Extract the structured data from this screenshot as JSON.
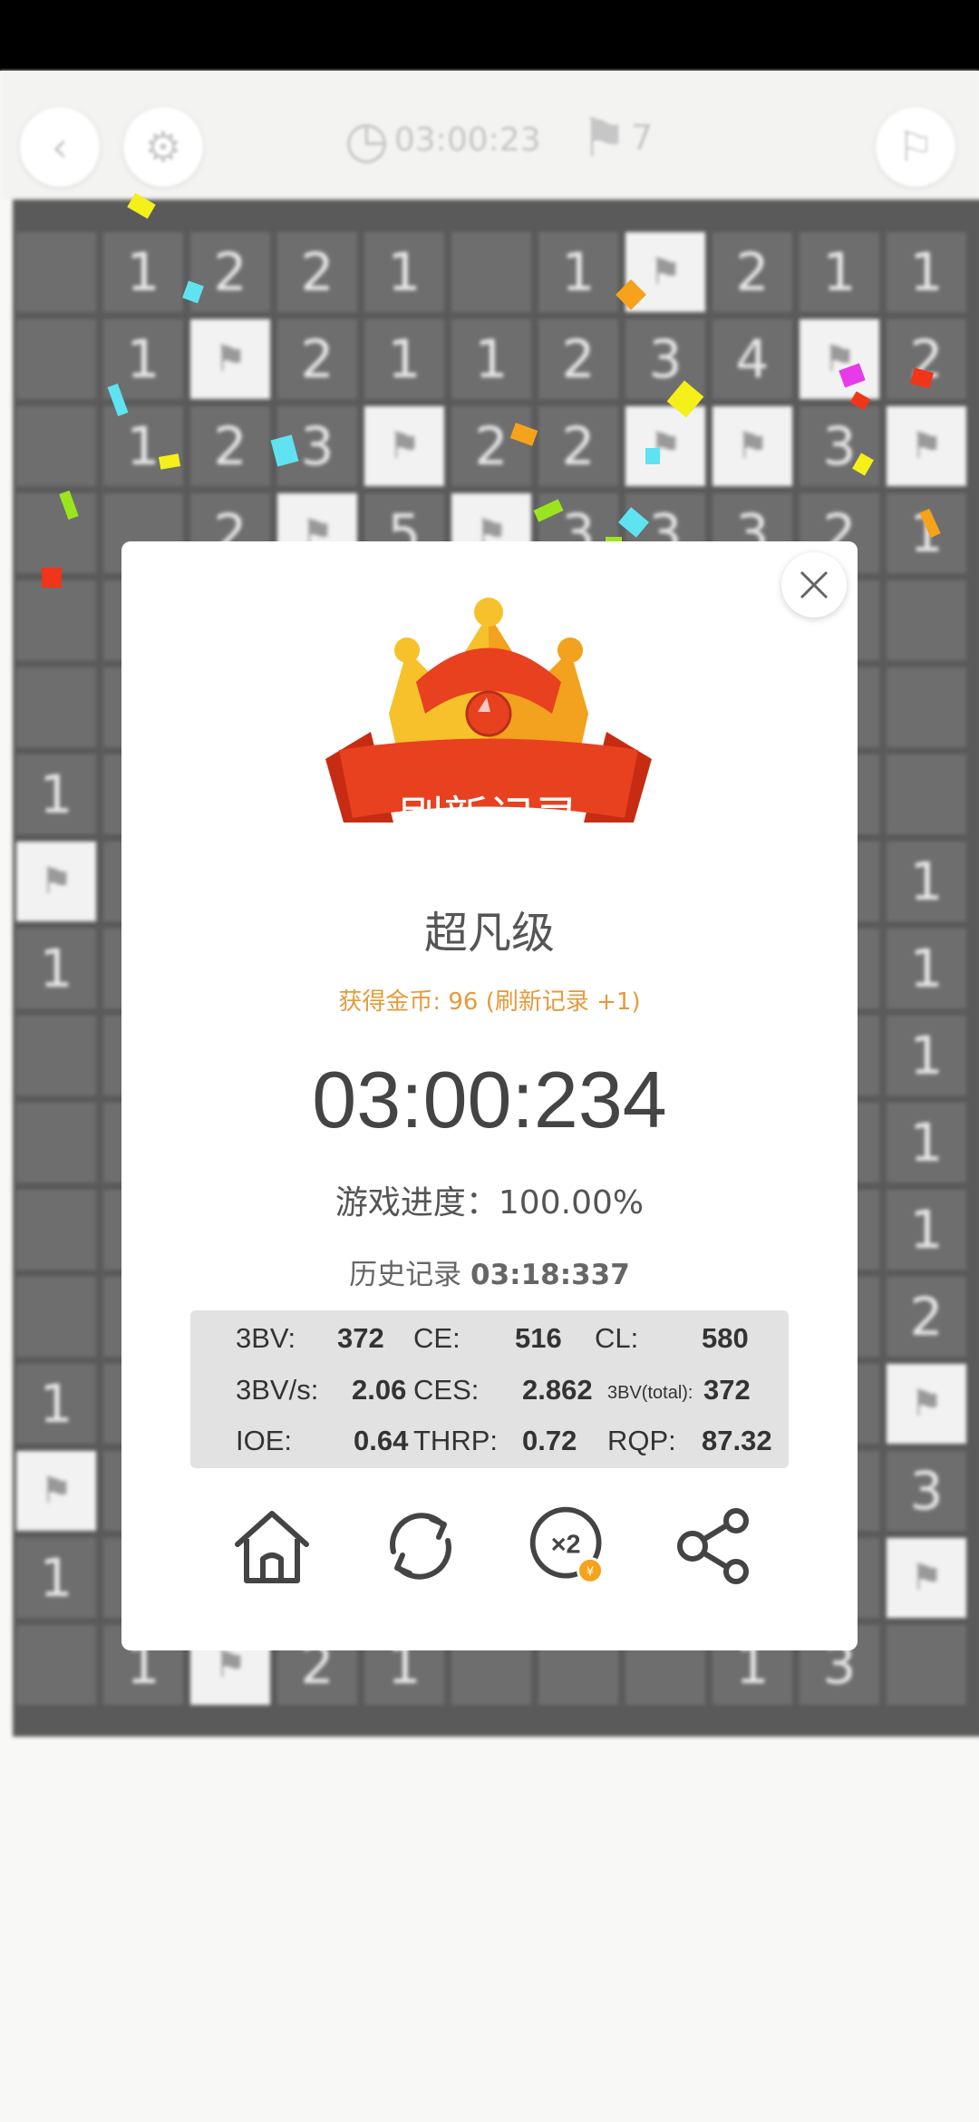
{
  "topbar": {
    "timer": "03:00:23",
    "flags": "7"
  },
  "dialog": {
    "banner": "刷新记录",
    "level": "超凡级",
    "coins": "获得金币: 96 (刷新记录 +1)",
    "time": "03:00:234",
    "progress": "游戏进度：100.00%",
    "history_label": "历史记录",
    "history_value": "03:18:337"
  },
  "stats": {
    "bv_label": "3BV:",
    "bv": "372",
    "ce_label": "CE:",
    "ce": "516",
    "cl_label": "CL:",
    "cl": "580",
    "bvs_label": "3BV/s:",
    "bvs": "2.06",
    "ces_label": "CES:",
    "ces": "2.862",
    "bvt_label": "3BV(total):",
    "bvt": "372",
    "ioe_label": "IOE:",
    "ioe": "0.64",
    "thrp_label": "THRP:",
    "thrp": "0.72",
    "rqp_label": "RQP:",
    "rqp": "87.32"
  },
  "board_rows": [
    [
      "",
      "1",
      "2",
      "2",
      "1",
      "",
      "1",
      "F",
      "2",
      "1",
      "1"
    ],
    [
      "",
      "1",
      "F",
      "2",
      "1",
      "1",
      "2",
      "3",
      "4",
      "F",
      "2"
    ],
    [
      "",
      "1",
      "2",
      "3",
      "F",
      "2",
      "2",
      "F",
      "F",
      "3",
      "F"
    ],
    [
      "",
      "",
      "2",
      "F",
      "5",
      "F",
      "3",
      "3",
      "3",
      "2",
      "1"
    ],
    [
      "",
      "",
      "",
      "",
      "",
      "",
      "",
      "",
      "",
      "",
      ""
    ],
    [
      "",
      "",
      "",
      "",
      "",
      "",
      "",
      "",
      "",
      "",
      ""
    ],
    [
      "1",
      "",
      "",
      "",
      "",
      "",
      "",
      "",
      "",
      "",
      ""
    ],
    [
      "F",
      "",
      "",
      "",
      "",
      "",
      "",
      "",
      "",
      "",
      "1"
    ],
    [
      "1",
      "",
      "",
      "",
      "",
      "",
      "",
      "",
      "",
      "",
      "1"
    ],
    [
      "",
      "",
      "",
      "",
      "",
      "",
      "",
      "",
      "",
      "",
      "1"
    ],
    [
      "",
      "",
      "",
      "",
      "",
      "",
      "",
      "",
      "",
      "",
      "1"
    ],
    [
      "",
      "",
      "",
      "",
      "",
      "",
      "",
      "",
      "",
      "",
      "1"
    ],
    [
      "",
      "",
      "",
      "",
      "",
      "",
      "",
      "",
      "",
      "",
      "2"
    ],
    [
      "1",
      "",
      "",
      "",
      "",
      "",
      "",
      "",
      "",
      "",
      "F"
    ],
    [
      "F",
      "",
      "",
      "",
      "",
      "",
      "",
      "",
      "",
      "",
      "3"
    ],
    [
      "1",
      "",
      "",
      "",
      "",
      "",
      "",
      "",
      "",
      "",
      "F"
    ],
    [
      "",
      "1",
      "F",
      "2",
      "1",
      "",
      "",
      "",
      "1",
      "3",
      ""
    ]
  ],
  "colors": {
    "accent_orange": "#e59a3a",
    "banner_red": "#e7411f",
    "crown_gold": "#f6c12b"
  },
  "icons": {
    "back": "chevron-left-icon",
    "settings": "gear-icon",
    "clock": "clock-icon",
    "flag": "flag-icon",
    "close": "close-icon",
    "home": "home-icon",
    "restart": "refresh-icon",
    "double": "double-coins-icon",
    "share": "share-icon"
  }
}
